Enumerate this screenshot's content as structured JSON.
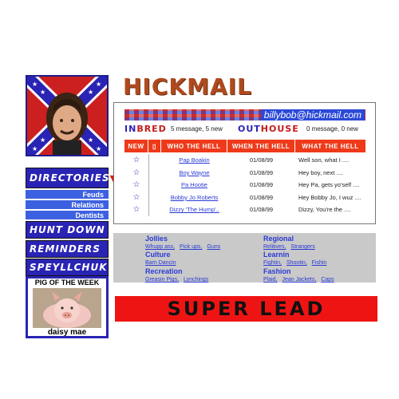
{
  "logo": {
    "text": "HICKMAIL"
  },
  "inbox": {
    "email": "billybob@hickmail.com",
    "inbred": {
      "prefix": "IN",
      "rest": "BRED",
      "count": "5 message, 5 new"
    },
    "outhouse": {
      "prefix": "OUT",
      "rest": "HOUSE",
      "count": "0 message, 0 new"
    },
    "columns": [
      "NEW",
      "WHO THE HELL",
      "WHEN THE HELL",
      "WHAT THE HELL"
    ],
    "messages": [
      {
        "from": "Pap Boakin",
        "date": "01/08/99",
        "subject": "Well son, what I ...."
      },
      {
        "from": "Boy Wayne",
        "date": "01/08/99",
        "subject": "Hey boy, next ...."
      },
      {
        "from": "Pa Hootie",
        "date": "01/08/99",
        "subject": "Hey Pa, gets yo'self ...."
      },
      {
        "from": "Bobby Jo Roberts",
        "date": "01/08/99",
        "subject": "Hey Bobby Jo, I wuz ...."
      },
      {
        "from": "Dizzy 'The Hump'..",
        "date": "01/08/99",
        "subject": "Dizzy, You're the ...."
      }
    ]
  },
  "nav": {
    "directories": "DIRECTORIES",
    "subs": [
      "Feuds",
      "Relations",
      "Dentists"
    ],
    "hunt": "HUNT DOWN",
    "reminders": "REMINDERS",
    "spey": "SPEYLLCHUK",
    "pig_title": "PIG OF THE WEEK",
    "pig_name": "daisy mae"
  },
  "categories": {
    "left": [
      {
        "title": "Jollies",
        "links": [
          "Whupp ass,",
          "Pick ups,",
          "Guns"
        ]
      },
      {
        "title": "Culture",
        "links": [
          "Barn Dancin"
        ]
      },
      {
        "title": "Recreation",
        "links": [
          "Greasin Pigs,",
          "Lynchings"
        ]
      }
    ],
    "right": [
      {
        "title": "Regional",
        "links": [
          "Relitives,",
          "Strangers"
        ]
      },
      {
        "title": "Learnin",
        "links": [
          "Fightin,",
          "Shootin,",
          "Fishin"
        ]
      },
      {
        "title": "Fashion",
        "links": [
          "Plaid,",
          "Jean Jackets,",
          "Caps"
        ]
      }
    ]
  },
  "banner": {
    "text": "SUPER LEAD"
  },
  "colors": {
    "nav_blue": "#2a24b5",
    "red": "#ee3a1a",
    "link_blue": "#2a3ad5"
  }
}
